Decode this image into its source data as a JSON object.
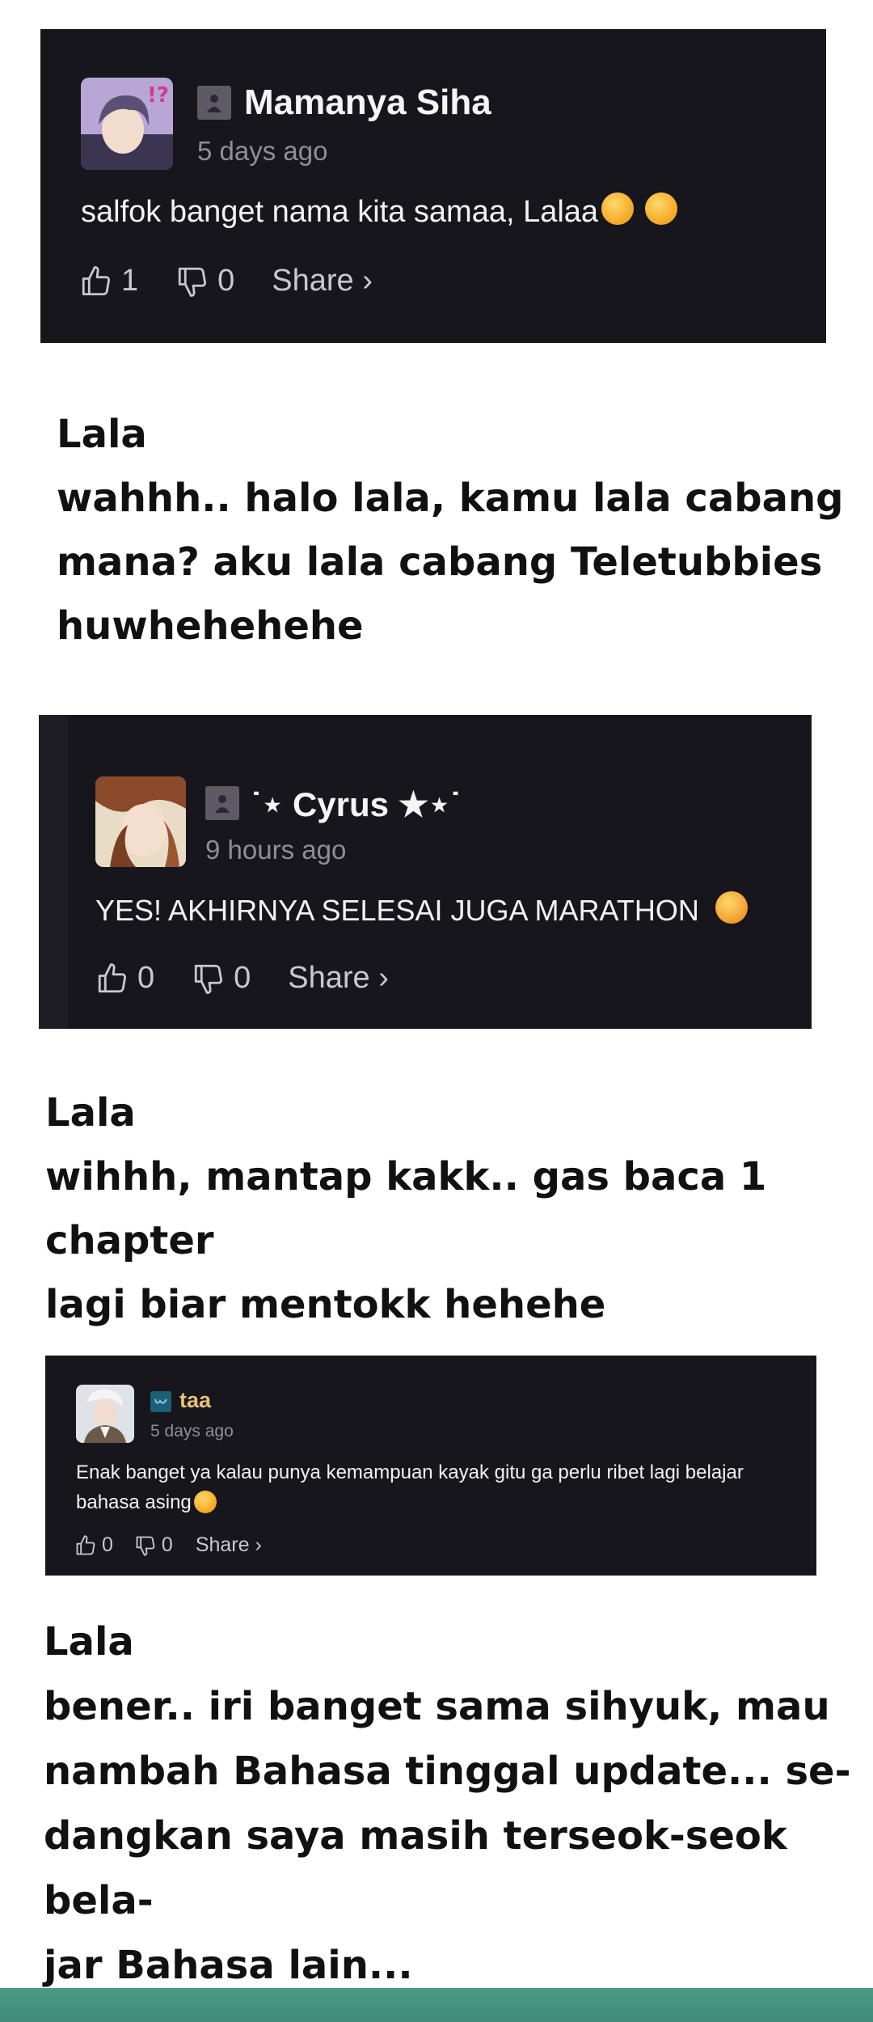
{
  "comments": [
    {
      "username": "Mamanya Siha",
      "time": "5 days ago",
      "text": "salfok banget nama kita samaa, Lalaa",
      "likes": "1",
      "dislikes": "0",
      "share": "Share ›"
    },
    {
      "username": "˙⋆ Cyrus ★⋆˙",
      "time": "9 hours ago",
      "text": "YES! AKHIRNYA SELESAI JUGA MARATHON",
      "likes": "0",
      "dislikes": "0",
      "share": "Share ›"
    },
    {
      "username": "taa",
      "time": "5 days ago",
      "text": "Enak banget ya kalau punya kemampuan kayak gitu ga perlu ribet lagi belajar bahasa asing",
      "likes": "0",
      "dislikes": "0",
      "share": "Share ›"
    }
  ],
  "replies": [
    {
      "name": "Lala",
      "text": "wahhh.. halo lala, kamu lala cabang\nmana? aku lala cabang Teletubbies\nhuwhehehehe"
    },
    {
      "name": "Lala",
      "text": "wihhh, mantap kakk.. gas baca 1 chapter\nlagi biar mentokk hehehe"
    },
    {
      "name": "Lala",
      "text": "bener.. iri banget sama sihyuk, mau\nnambah Bahasa tinggal update... se-\ndangkan saya masih terseok-seok bela-\njar Bahasa lain..."
    }
  ],
  "icons": {
    "like": "thumbs-up-icon",
    "dislike": "thumbs-down-icon",
    "badge": "user-badge-icon",
    "emoji": "emoji-icon"
  },
  "colors": {
    "card_bg": "#17161d",
    "footer_band": "#4c9a86",
    "taa_name": "#e7c27a"
  }
}
